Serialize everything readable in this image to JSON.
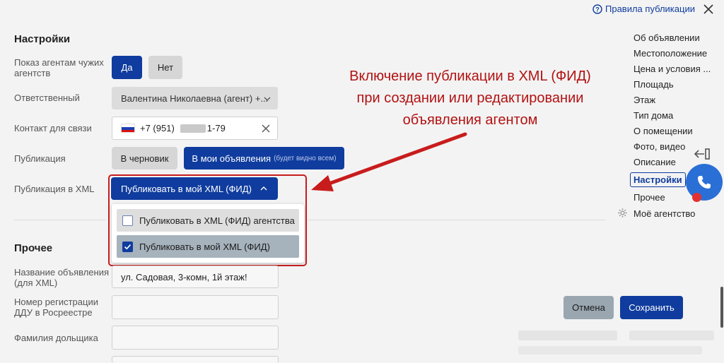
{
  "header": {
    "help_link": "Правила публикации"
  },
  "settings": {
    "title": "Настройки",
    "show_agents_label": "Показ агентам чужих агентств",
    "show_agents_line1": "Показ агентам чужих",
    "show_agents_line2": "агентств",
    "yes": "Да",
    "no": "Нет",
    "responsible_label": "Ответственный",
    "responsible_value": "Валентина Николаевна (агент) +...",
    "contact_label": "Контакт для связи",
    "contact_prefix": "+7 (951)",
    "contact_suffix": "1-79",
    "publication_label": "Публикация",
    "draft_button": "В черновик",
    "my_ads_button": "В мои объявления",
    "my_ads_note": "(будет видно всем)",
    "xml_label": "Публикация в XML",
    "xml_selected": "Публиковать в мой XML (ФИД)",
    "xml_options": [
      {
        "label": "Публиковать в XML (ФИД) агентства",
        "checked": false
      },
      {
        "label": "Публиковать в мой XML (ФИД)",
        "checked": true
      }
    ]
  },
  "other": {
    "title": "Прочее",
    "ad_name_line1": "Название объявления",
    "ad_name_line2": "(для XML)",
    "ad_name_value": "ул. Садовая, 3-комн, 1й этаж!",
    "ddu_line1": "Номер регистрации",
    "ddu_line2": "ДДУ в Росреестре",
    "shareholder_label": "Фамилия дольщика"
  },
  "annotation": {
    "line1": "Включение публикации в XML (ФИД)",
    "line2": "при создании или редактировании",
    "line3": "объявления агентом"
  },
  "sidebar": {
    "items": [
      "Об объявлении",
      "Местоположение",
      "Цена и условия ...",
      "Площадь",
      "Этаж",
      "Тип дома",
      "О помещении",
      "Фото, видео",
      "Описание",
      "Настройки",
      "Прочее",
      "Моё агентство"
    ]
  },
  "footer": {
    "cancel": "Отмена",
    "save": "Сохранить"
  },
  "colors": {
    "accent": "#0f3c9e",
    "annotation": "#b21212"
  },
  "icons": [
    "help-circle-icon",
    "close-icon",
    "chevron-down-icon",
    "chevron-up-icon",
    "russia-flag-icon",
    "clear-icon",
    "checkbox-icon",
    "gear-icon",
    "collapse-panel-icon",
    "phone-icon"
  ]
}
